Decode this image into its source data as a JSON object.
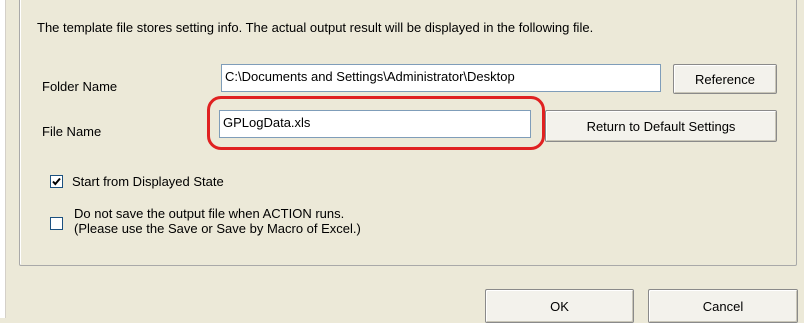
{
  "output_settings": {
    "info_text": "The template file stores setting info. The actual output result will be displayed in the following file.",
    "folder_name_label": "Folder Name",
    "folder_name_value": "C:\\Documents and Settings\\Administrator\\Desktop",
    "reference_button": "Reference",
    "file_name_label": "File Name",
    "file_name_value": "GPLogData.xls",
    "return_default_button": "Return to Default Settings",
    "start_displayed_label": "Start from Displayed State",
    "start_displayed_checked": true,
    "no_save_label_line1": "Do not save the output file when ACTION runs.",
    "no_save_label_line2": "(Please use the Save or Save by Macro of Excel.)",
    "no_save_checked": false
  },
  "dialog_buttons": {
    "ok": "OK",
    "cancel": "Cancel"
  },
  "colors": {
    "highlight": "#e02121",
    "dialog_bg": "#ece9d8"
  }
}
